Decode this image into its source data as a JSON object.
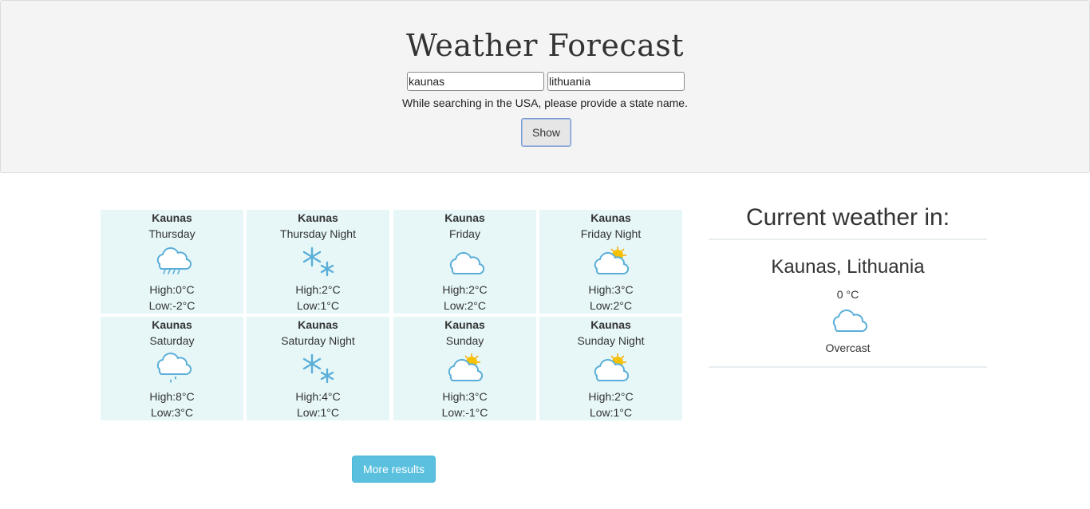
{
  "header": {
    "title": "Weather Forecast",
    "city_value": "kaunas",
    "country_value": "lithuania",
    "hint": "While searching in the USA, please provide a state name.",
    "show_label": "Show"
  },
  "forecast": [
    {
      "city": "Kaunas",
      "day": "Thursday",
      "high": "High:0°C",
      "low": "Low:-2°C",
      "icon": "rain-cloud-icon"
    },
    {
      "city": "Kaunas",
      "day": "Thursday Night",
      "high": "High:2°C",
      "low": "Low:1°C",
      "icon": "snowflake-icon"
    },
    {
      "city": "Kaunas",
      "day": "Friday",
      "high": "High:2°C",
      "low": "Low:2°C",
      "icon": "cloud-icon"
    },
    {
      "city": "Kaunas",
      "day": "Friday Night",
      "high": "High:3°C",
      "low": "Low:2°C",
      "icon": "partly-cloudy-icon"
    },
    {
      "city": "Kaunas",
      "day": "Saturday",
      "high": "High:8°C",
      "low": "Low:3°C",
      "icon": "drizzle-cloud-icon"
    },
    {
      "city": "Kaunas",
      "day": "Saturday Night",
      "high": "High:4°C",
      "low": "Low:1°C",
      "icon": "snowflake-icon"
    },
    {
      "city": "Kaunas",
      "day": "Sunday",
      "high": "High:3°C",
      "low": "Low:-1°C",
      "icon": "partly-cloudy-icon"
    },
    {
      "city": "Kaunas",
      "day": "Sunday Night",
      "high": "High:2°C",
      "low": "Low:1°C",
      "icon": "partly-cloudy-icon"
    }
  ],
  "current": {
    "title": "Current weather in:",
    "location": "Kaunas, Lithuania",
    "temp": "0 °C",
    "icon": "cloud-icon",
    "description": "Overcast"
  },
  "more_label": "More results",
  "colors": {
    "card_bg": "#e7f7f8",
    "icon_blue": "#5aaed8",
    "sun": "#f6c200",
    "more_btn": "#5bc0de"
  }
}
